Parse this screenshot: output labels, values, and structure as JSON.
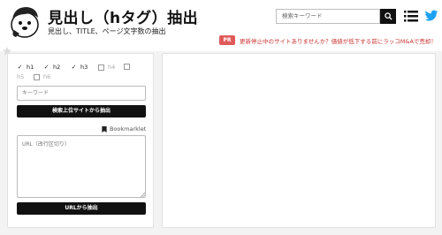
{
  "header": {
    "title": "見出し（hタグ）抽出",
    "subtitle": "見出し、TITLE、ページ文字数の抽出",
    "search_placeholder": "検索キーワード"
  },
  "pr": {
    "badge": "PR",
    "text": "更新停止中のサイトありませんか？価値が低下する前にラッコM&Aで売却！"
  },
  "form": {
    "headings": [
      {
        "label": "h1",
        "checked": true
      },
      {
        "label": "h2",
        "checked": true
      },
      {
        "label": "h3",
        "checked": true
      },
      {
        "label": "h4",
        "checked": false
      },
      {
        "label": "h5",
        "checked": false
      },
      {
        "label": "h6",
        "checked": false
      }
    ],
    "keyword_placeholder": "キーワード",
    "search_button": "検索上位サイトから抽出",
    "bookmarklet": "Bookmarklet",
    "url_placeholder": "URL（改行区切り）",
    "url_button": "URLから抽出"
  },
  "colors": {
    "accent_pr": "#e05a5a",
    "button": "#111111",
    "twitter": "#1da1f2"
  }
}
